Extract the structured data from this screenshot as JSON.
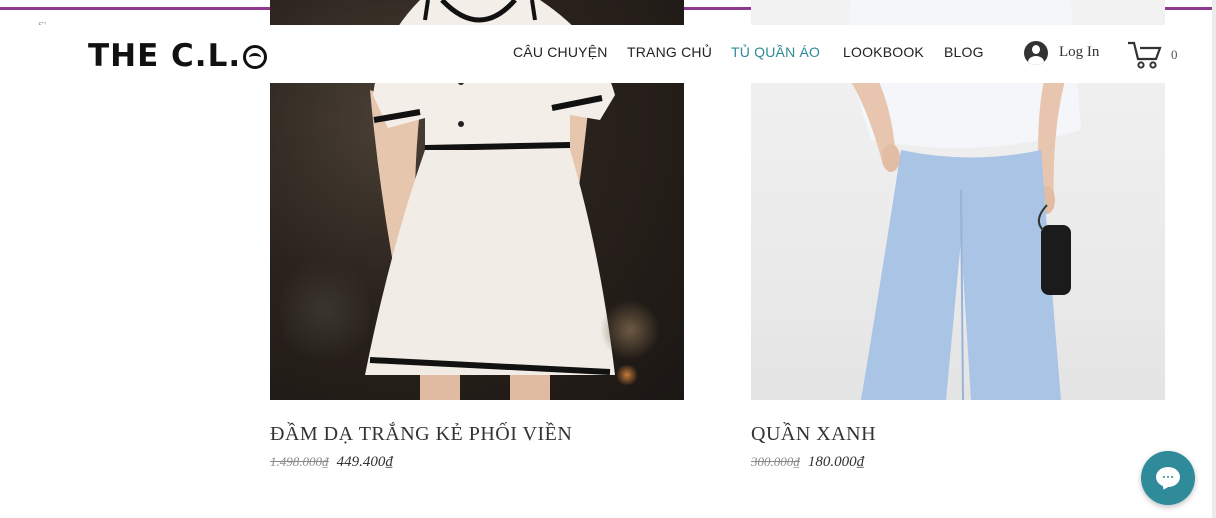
{
  "side_fragments": [
    "S'",
    "–"
  ],
  "header": {
    "logo": "THE C.L.",
    "nav": [
      {
        "label": "CÂU CHUYỆN",
        "active": false
      },
      {
        "label": "TRANG CHỦ",
        "active": false
      },
      {
        "label": "TỦ QUẦN ÁO",
        "active": true
      },
      {
        "label": "LOOKBOOK",
        "active": false
      },
      {
        "label": "BLOG",
        "active": false
      }
    ],
    "login_label": "Log In",
    "cart_count": "0"
  },
  "products": [
    {
      "name": "ĐẦM DẠ TRẮNG KẺ PHỐI VIỀN",
      "old_price": "1.498.000₫",
      "price": "449.400₫"
    },
    {
      "name": "QUẦN XANH",
      "old_price": "300.000₫",
      "price": "180.000₫"
    }
  ],
  "colors": {
    "accent": "#2f8a99",
    "top_border": "#8e3a8e"
  },
  "icons": [
    "user-icon",
    "cart-icon",
    "chat-icon"
  ]
}
